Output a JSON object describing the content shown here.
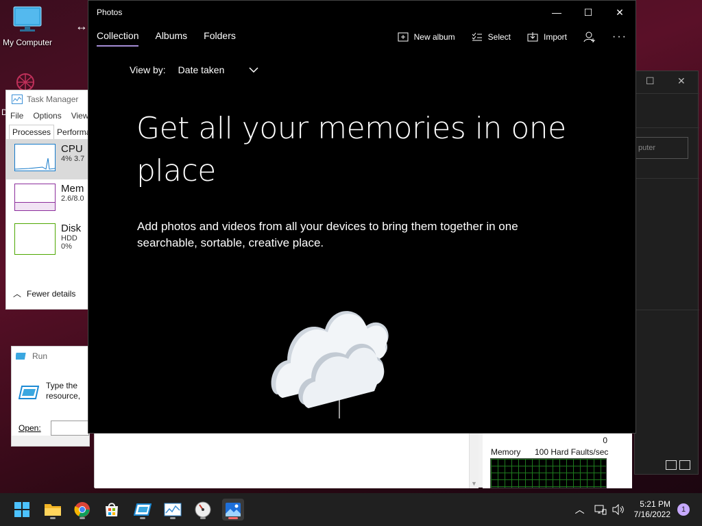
{
  "desktop": {
    "icon_label": "My Computer",
    "side_letter": "D"
  },
  "task_manager": {
    "title": "Task Manager",
    "menu": [
      "File",
      "Options",
      "View"
    ],
    "tabs": [
      "Processes",
      "Performa"
    ],
    "items": [
      {
        "name": "CPU",
        "sub": "4%  3.7",
        "color": "#1479c9"
      },
      {
        "name": "Mem",
        "sub": "2.6/8.0",
        "color": "#8b2d9b"
      },
      {
        "name": "Disk",
        "sub": "HDD",
        "sub2": "0%",
        "color": "#4da700"
      }
    ],
    "fewer_details": "Fewer details"
  },
  "run_dialog": {
    "title": "Run",
    "description": "Type the resource,",
    "open_label": "Open:"
  },
  "back_window": {
    "field_text": "puter"
  },
  "resource_monitor": {
    "zero": "0",
    "memory_label": "Memory",
    "faults_label": "100 Hard Faults/sec"
  },
  "photos": {
    "title": "Photos",
    "tabs": [
      "Collection",
      "Albums",
      "Folders"
    ],
    "actions": {
      "new_album": "New album",
      "select": "Select",
      "import": "Import"
    },
    "view_by_label": "View by:",
    "view_by_value": "Date taken",
    "heading": "Get all your memories in one place",
    "subtext": "Add photos and videos from all your devices to bring them together in one searchable, sortable, creative place."
  },
  "taskbar": {
    "time": "5:21 PM",
    "date": "7/16/2022",
    "notifications": "1"
  },
  "colors": {
    "accent": "#a58dd6",
    "taskbar_active_indicator": "#ff6b6b"
  }
}
